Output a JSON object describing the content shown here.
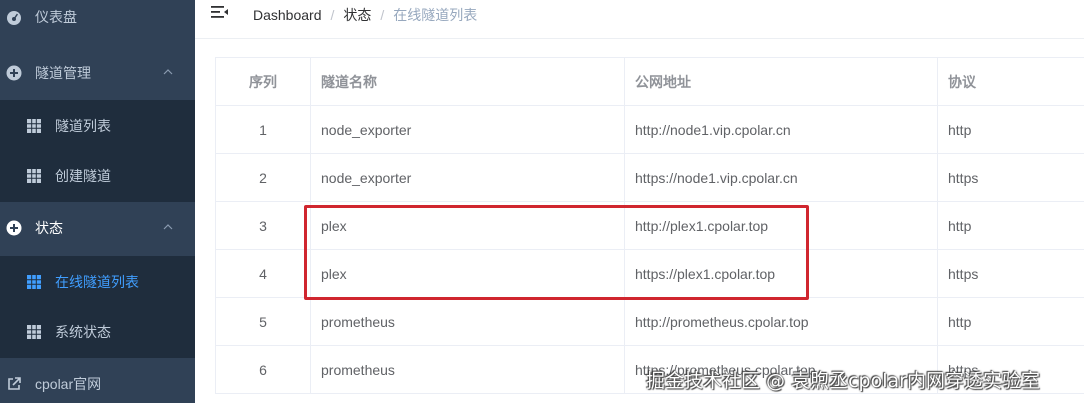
{
  "sidebar": {
    "dashboard": "仪表盘",
    "tunnel_mgmt": "隧道管理",
    "tunnel_list": "隧道列表",
    "create_tunnel": "创建隧道",
    "status": "状态",
    "online_tunnels": "在线隧道列表",
    "system_status": "系统状态",
    "official_site": "cpolar官网"
  },
  "breadcrumb": {
    "home": "Dashboard",
    "sep": "/",
    "level2": "状态",
    "current": "在线隧道列表"
  },
  "table": {
    "headers": [
      "序列",
      "隧道名称",
      "公网地址",
      "协议"
    ],
    "rows": [
      [
        "1",
        "node_exporter",
        "http://node1.vip.cpolar.cn",
        "http"
      ],
      [
        "2",
        "node_exporter",
        "https://node1.vip.cpolar.cn",
        "https"
      ],
      [
        "3",
        "plex",
        "http://plex1.cpolar.top",
        "http"
      ],
      [
        "4",
        "plex",
        "https://plex1.cpolar.top",
        "https"
      ],
      [
        "5",
        "prometheus",
        "http://prometheus.cpolar.top",
        "http"
      ],
      [
        "6",
        "prometheus",
        "https://prometheus.cpolar.top",
        "https"
      ]
    ]
  },
  "watermark": "掘金技术社区 @ 袁煦丞cpolar内网穿透实验室",
  "colors": {
    "sidebar_bg": "#304156",
    "submenu_bg": "#1f2d3d",
    "active": "#409eff",
    "highlight": "#d0262f"
  }
}
